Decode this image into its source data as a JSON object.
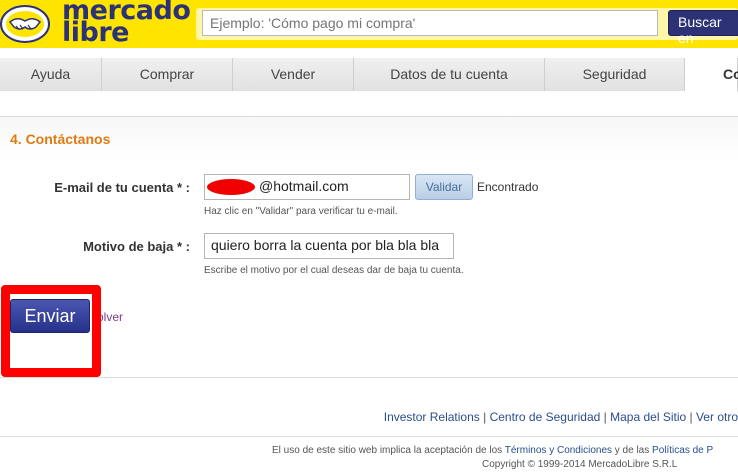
{
  "header": {
    "logo_line1": "mercado",
    "logo_line2": "libre",
    "search_placeholder": "Ejemplo: 'Cómo pago mi compra'",
    "search_button": "Buscar en"
  },
  "tabs": [
    {
      "label": "Ayuda",
      "active": false
    },
    {
      "label": "Comprar",
      "active": false
    },
    {
      "label": "Vender",
      "active": false
    },
    {
      "label": "Datos de tu cuenta",
      "active": false
    },
    {
      "label": "Seguridad",
      "active": false
    },
    {
      "label": "Co",
      "active": true
    }
  ],
  "section": {
    "title": "4. Contáctanos"
  },
  "form": {
    "email_label": "E-mail de tu cuenta * :",
    "email_value": "@hotmail.com",
    "email_hint": "Haz clic en \"Validar\" para verificar tu e-mail.",
    "validate_button": "Validar",
    "validate_status": "Encontrado",
    "reason_label": "Motivo de baja * :",
    "reason_value": "quiero borra la cuenta por bla bla bla",
    "reason_hint": "Escribe el motivo por el cual deseas dar de baja tu cuenta.",
    "submit_button": "Enviar",
    "back_link": "olver"
  },
  "footer": {
    "links": [
      "Investor Relations",
      "Centro de Seguridad",
      "Mapa del Sitio",
      "Ver otro"
    ],
    "separator": " | ",
    "legal_prefix": "El uso de este sitio web implica la aceptación de los ",
    "legal_link1": "Términos y Condiciones",
    "legal_mid": " y de las ",
    "legal_link2": "Políticas de P",
    "copyright": "Copyright © 1999-2014 MercadoLibre S.R.L"
  },
  "colors": {
    "brand_yellow": "#fde500",
    "brand_navy": "#2d3277",
    "section_orange": "#e07a10",
    "annotation_red": "#ff0000"
  }
}
